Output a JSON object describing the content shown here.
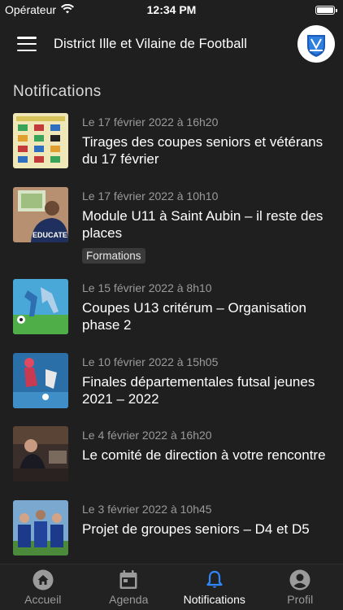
{
  "status_bar": {
    "carrier": "Opérateur",
    "time": "12:34 PM"
  },
  "header": {
    "title": "District Ille et Vilaine de Football"
  },
  "section_title": "Notifications",
  "notifications": [
    {
      "date": "Le 17 février 2022 à 16h20",
      "title": "Tirages des coupes seniors et vétérans du 17 février",
      "tag": ""
    },
    {
      "date": "Le 17 février 2022 à 10h10",
      "title": "Module U11 à Saint Aubin – il reste des places",
      "tag": "Formations",
      "thumb_text": "EDUCATE"
    },
    {
      "date": "Le 15 février 2022 à 8h10",
      "title": "Coupes U13 critérum – Organisation phase 2",
      "tag": ""
    },
    {
      "date": "Le 10 février 2022 à 15h05",
      "title": "Finales départementales futsal jeunes 2021 – 2022",
      "tag": ""
    },
    {
      "date": "Le 4 février 2022 à 16h20",
      "title": "Le comité de direction à votre rencontre",
      "tag": ""
    },
    {
      "date": "Le 3 février 2022 à 10h45",
      "title": "Projet de groupes seniors – D4 et D5",
      "tag": ""
    }
  ],
  "tabs": [
    {
      "label": "Accueil",
      "icon": "home-icon"
    },
    {
      "label": "Agenda",
      "icon": "calendar-icon"
    },
    {
      "label": "Notifications",
      "icon": "bell-icon",
      "active": true
    },
    {
      "label": "Profil",
      "icon": "profile-icon"
    }
  ],
  "colors": {
    "background": "#1f1f1f",
    "tab_bar": "#222222",
    "date_text": "#9a9a9a",
    "tag_bg": "#3a3a3a",
    "active_tab": "#ffffff",
    "inactive_tab": "#9b9b9b"
  }
}
